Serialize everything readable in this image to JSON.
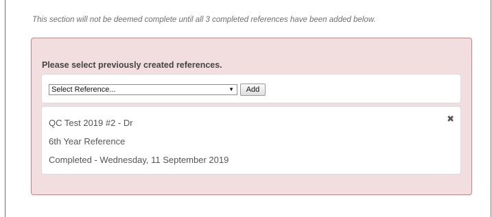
{
  "notice": "This section will not be deemed complete until all 3 completed references have been added below.",
  "panel": {
    "heading": "Please select previously created references.",
    "select": {
      "selected": "Select Reference..."
    },
    "add_label": "Add"
  },
  "reference": {
    "name": "QC Test 2019 #2 - Dr",
    "type": "6th Year Reference",
    "status": "Completed - Wednesday, 11 September 2019",
    "remove_icon": "close-icon"
  },
  "colors": {
    "panel_background": "#f2dede",
    "panel_border": "#e07b7b"
  }
}
